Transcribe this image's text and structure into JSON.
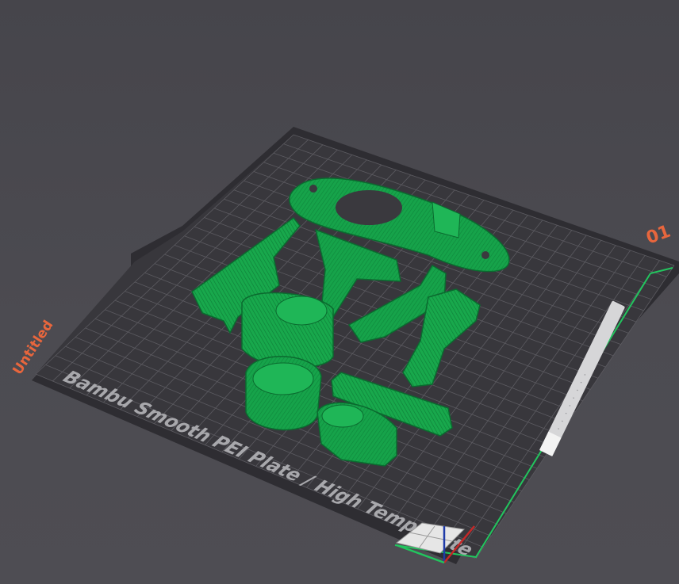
{
  "scene": {
    "plate_name": "Bambu Smooth PEI Plate / High Temp Plate",
    "plate_number": "01",
    "project_label": "Untitled"
  },
  "colors": {
    "background": "#4b4a50",
    "bed_surface": "#38373c",
    "bed_grid": "#5c5b61",
    "bed_edge": "#2b2a2f",
    "model_green": "#16a34a",
    "model_green_dark": "#0f7a36",
    "accent_orange": "#e8663d",
    "boundary_green": "#22c55e"
  },
  "icons": {
    "orientation_cube": "view-cube-icon",
    "axis_gizmo": "xyz-axis-icon"
  }
}
